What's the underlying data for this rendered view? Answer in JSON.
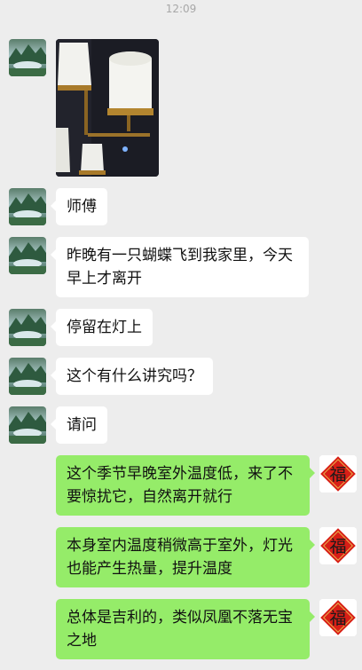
{
  "chat": {
    "timestamp": "12:09",
    "messages": [
      {
        "side": "left",
        "type": "image",
        "alt": "lamp photo"
      },
      {
        "side": "left",
        "type": "text",
        "text": "师傅"
      },
      {
        "side": "left",
        "type": "text",
        "text": "昨晚有一只蝴蝶飞到我家里，今天早上才离开"
      },
      {
        "side": "left",
        "type": "text",
        "text": "停留在灯上"
      },
      {
        "side": "left",
        "type": "text",
        "text": "这个有什么讲究吗？"
      },
      {
        "side": "left",
        "type": "text",
        "text": "请问"
      },
      {
        "side": "right",
        "type": "text",
        "text": "这个季节早晚室外温度低，来了不要惊扰它，自然离开就行"
      },
      {
        "side": "right",
        "type": "text",
        "text": "本身室内温度稍微高于室外，灯光也能产生热量，提升温度"
      },
      {
        "side": "right",
        "type": "text",
        "text": "总体是吉利的，类似凤凰不落无宝之地"
      }
    ],
    "avatar_right_glyph": "福"
  },
  "colors": {
    "background": "#ededed",
    "incoming_bubble": "#ffffff",
    "outgoing_bubble": "#95ec69",
    "fu_red": "#d81e16",
    "fu_gold": "#e8b04a"
  }
}
